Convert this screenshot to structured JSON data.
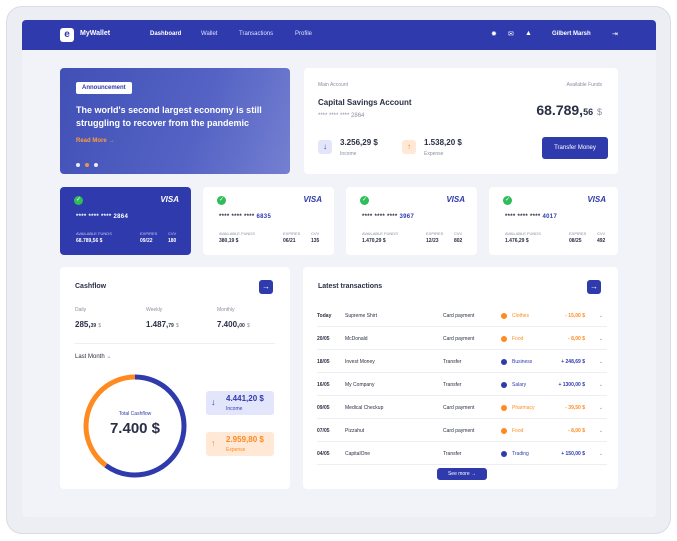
{
  "nav": {
    "brand": "MyWallet",
    "links": [
      "Dashboard",
      "Wallet",
      "Transactions",
      "Profile"
    ],
    "user": "Gilbert Marsh"
  },
  "banner": {
    "badge": "Announcement",
    "text": "The world's second largest economy is still struggling to recover from the pandemic",
    "read_more": "Read More"
  },
  "account": {
    "label": "Main Account",
    "name": "Capital Savings Account",
    "masked": "**** **** ****",
    "last4": "2864",
    "available_label": "Available Funds",
    "balance_main": "68.789,",
    "balance_cents": "56",
    "balance_currency": "$",
    "income_value": "3.256,29 $",
    "income_label": "Income",
    "expense_value": "1.538,20 $",
    "expense_label": "Expense",
    "transfer_button": "Transfer Money"
  },
  "cards": [
    {
      "brand": "VISA",
      "masked": "**** **** ****",
      "last4": "2864",
      "funds_label": "AVAILABLE FUNDS",
      "expires_label": "EXPIRES",
      "cvv_label": "CVV",
      "funds": "68.789,56 $",
      "expires": "09/22",
      "cvv": "180"
    },
    {
      "brand": "VISA",
      "masked": "**** **** ****",
      "last4": "6835",
      "funds_label": "AVAILABLE FUNDS",
      "expires_label": "EXPIRES",
      "cvv_label": "CVV",
      "funds": "380,19 $",
      "expires": "06/21",
      "cvv": "135"
    },
    {
      "brand": "VISA",
      "masked": "**** **** ****",
      "last4": "3967",
      "funds_label": "AVAILABLE FUNDS",
      "expires_label": "EXPIRES",
      "cvv_label": "CVV",
      "funds": "1.470,29 $",
      "expires": "12/23",
      "cvv": "802"
    },
    {
      "brand": "VISA",
      "masked": "**** **** ****",
      "last4": "4017",
      "funds_label": "AVAILABLE FUNDS",
      "expires_label": "EXPIRES",
      "cvv_label": "CVV",
      "funds": "1.476,29 $",
      "expires": "08/25",
      "cvv": "492"
    }
  ],
  "cashflow": {
    "title": "Cashflow",
    "periods": [
      {
        "label": "Daily",
        "value": "285,",
        "cents": "39",
        "currency": "$"
      },
      {
        "label": "Weekly",
        "value": "1.487,",
        "cents": "79",
        "currency": "$"
      },
      {
        "label": "Monthly",
        "value": "7.400,",
        "cents": "00",
        "currency": "$"
      }
    ],
    "filter": "Last Month",
    "total_label": "Total Cashflow",
    "total_value": "7.400 $",
    "income_fraction": 0.6,
    "income_value": "4.441,20 $",
    "income_label": "Income",
    "expense_value": "2.959,80 $",
    "expense_label": "Expense"
  },
  "transactions": {
    "title": "Latest transactions",
    "see_more": "See more",
    "rows": [
      {
        "date": "Today",
        "name": "Supreme Shirt",
        "method": "Card payment",
        "category": "Clothes",
        "color": "#ff8a1f",
        "amount": "- 15,00 $"
      },
      {
        "date": "20/05",
        "name": "McDonald",
        "method": "Card payment",
        "category": "Food",
        "color": "#ff8a1f",
        "amount": "- 8,00 $"
      },
      {
        "date": "18/05",
        "name": "Invest Money",
        "method": "Transfer",
        "category": "Business",
        "color": "#2f3aad",
        "amount": "+ 248,69 $"
      },
      {
        "date": "16/05",
        "name": "My Company",
        "method": "Transfer",
        "category": "Salary",
        "color": "#2f3aad",
        "amount": "+ 1300,00 $"
      },
      {
        "date": "09/05",
        "name": "Medical Checkup",
        "method": "Card payment",
        "category": "Pharmacy",
        "color": "#ff8a1f",
        "amount": "- 39,50 $"
      },
      {
        "date": "07/05",
        "name": "Pizzahut",
        "method": "Card payment",
        "category": "Food",
        "color": "#ff8a1f",
        "amount": "- 8,00 $"
      },
      {
        "date": "04/05",
        "name": "CapitalOne",
        "method": "Transfer",
        "category": "Trading",
        "color": "#2f3aad",
        "amount": "+ 150,00 $"
      }
    ]
  }
}
